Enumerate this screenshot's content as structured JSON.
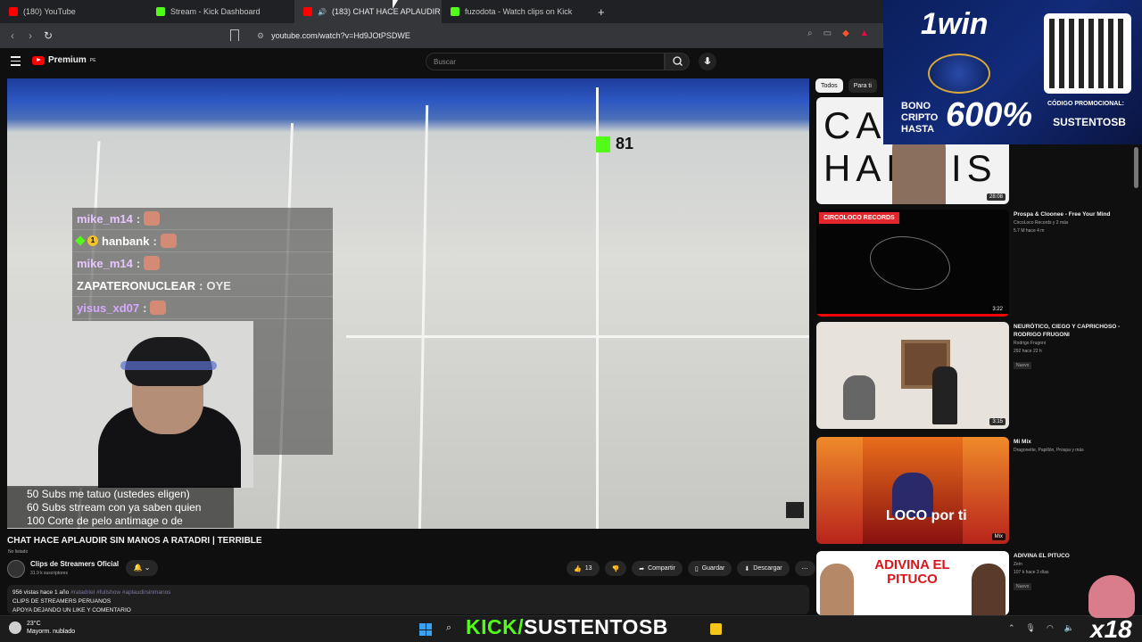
{
  "browser": {
    "tabs": [
      {
        "label": "(180) YouTube",
        "icon": "youtube-favicon"
      },
      {
        "label": "Stream - Kick Dashboard",
        "icon": "kick-favicon"
      },
      {
        "label": "(183) CHAT HACE APLAUDIR",
        "icon": "youtube-favicon"
      },
      {
        "label": "fuzodota - Watch clips on Kick",
        "icon": "kick-favicon"
      }
    ],
    "url": "youtube.com/watch?v=Hd9JOtPSDWE"
  },
  "youtube": {
    "logo": "Premium",
    "logo_sup": "PE",
    "search_placeholder": "Buscar"
  },
  "stream": {
    "kick_viewers": "81",
    "chat": [
      {
        "user": "mike_m14",
        "sep": ":",
        "msg": ""
      },
      {
        "user": "hanbank",
        "sep": ":",
        "msg": ""
      },
      {
        "user": "mike_m14",
        "sep": ":",
        "msg": ""
      },
      {
        "user": "ZAPATERONUCLEAR",
        "sep": ":",
        "msg": "OYE"
      },
      {
        "user": "yisus_xd07",
        "sep": ":",
        "msg": ""
      }
    ],
    "goals": [
      "50 Subs me tatuo (ustedes eligen)",
      "60 Subs strream con ya saben quien",
      "100 Corte de pelo antimage o de gampi"
    ]
  },
  "video": {
    "title": "CHAT HACE APLAUDIR SIN MANOS A RATADRI | TERRIBLE",
    "unlisted": "No listado",
    "channel": "Clips de Streamers Oficial",
    "subs": "31.9 k suscriptores",
    "likes": "13",
    "share": "Compartir",
    "save": "Guardar",
    "download": "Descargar",
    "desc_stats": "956 vistas  hace 1 año",
    "desc_tags": "#ratadriel #fullshow #aplaudirsinmanos",
    "desc_line1": "CLIPS DE STREAMERS PERUANOS",
    "desc_line2": "APOYA DEJANDO UN LIKE Y COMENTARIO"
  },
  "chips": [
    "Todos",
    "Para ti"
  ],
  "recommendations": [
    {
      "title": "",
      "meta1": "",
      "meta2": "",
      "duration": "28:08",
      "thumb_text": "CA HARRIS"
    },
    {
      "title": "Prospa & Cloonee - Free Your Mind",
      "meta1": "CircoLoco Records y 2 más",
      "meta2": "5.7 M  hace 4 m",
      "duration": "3:22",
      "thumb_text": "CIRCOLOCO RECORDS"
    },
    {
      "title": "NEURÓTICO, CIEGO Y CAPRICHOSO - RODRIGO FRUGONI",
      "meta1": "Rodrigo Frugoni",
      "meta2": "292  hace 22 h",
      "badge": "Nuevo",
      "duration": "3:15"
    },
    {
      "title": "Mi Mix",
      "meta1": "Dragonette, Papillón, Prospa y más",
      "meta2": "",
      "duration": "Mix",
      "thumb_text": "LOCO por ti"
    },
    {
      "title": "ADIVINA EL PITUCO",
      "meta1": "Zein",
      "meta2": "107 k  hace 3 días",
      "badge": "Nuevo",
      "thumb_text": "ADIVINA EL PITUCO"
    }
  ],
  "ad": {
    "logo": "1win",
    "bono": "BONO CRIPTO HASTA",
    "pct": "600%",
    "code_label": "CÓDIGO PROMOCIONAL:",
    "code": "SUSTENTOSB"
  },
  "taskbar": {
    "temp": "23°C",
    "weather": "Mayorm. nublado",
    "overlay_green": "KICK/",
    "overlay_white": "SUSTENTOSB",
    "badge": "x18"
  },
  "colors": {
    "kick_green": "#53fc18",
    "yt_red": "#ff0000",
    "background": "#0f0f0f"
  }
}
